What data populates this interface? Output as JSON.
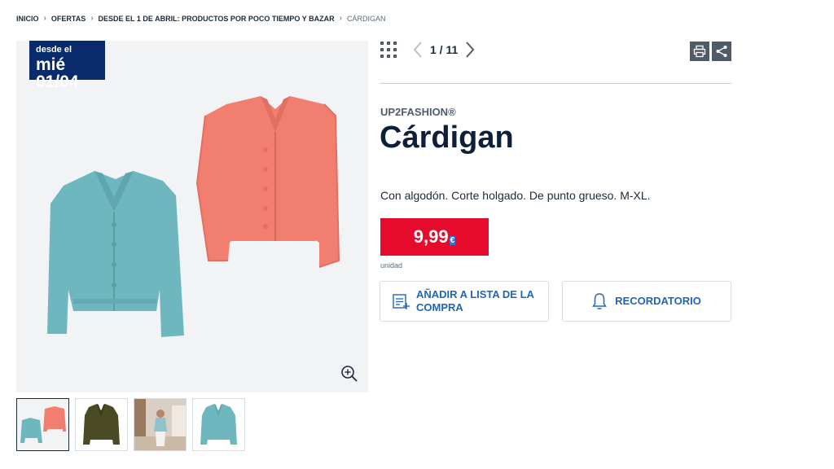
{
  "breadcrumb": {
    "items": [
      "INICIO",
      "OFERTAS",
      "DESDE EL 1 DE ABRIL: PRODUCTOS POR POCO TIEMPO Y BAZAR"
    ],
    "current": "CÁRDIGAN"
  },
  "badge": {
    "line1": "desde el",
    "line2": "mié 01/04"
  },
  "pager": {
    "text": "1 / 11"
  },
  "product": {
    "brand": "UP2FASHION®",
    "title": "Cárdigan",
    "description": "Con algodón. Corte holgado. De punto grueso. M-XL.",
    "price": "9,99",
    "currency": "€",
    "unit": "unidad"
  },
  "buttons": {
    "shopping_list": "AÑADIR A LISTA DE LA COMPRA",
    "reminder": "RECORDATORIO"
  },
  "colors": {
    "badge_bg": "#0a2b6b",
    "price_bg": "#e60a2d",
    "action_text": "#1f66b8",
    "cardigan_teal": "#6fb7bf",
    "cardigan_coral": "#f27e70",
    "cardigan_olive": "#4a4a24"
  },
  "icons": [
    "grid-icon",
    "chevron-left-icon",
    "chevron-right-icon",
    "print-icon",
    "share-icon",
    "zoom-in-icon",
    "list-add-icon",
    "bell-icon"
  ]
}
